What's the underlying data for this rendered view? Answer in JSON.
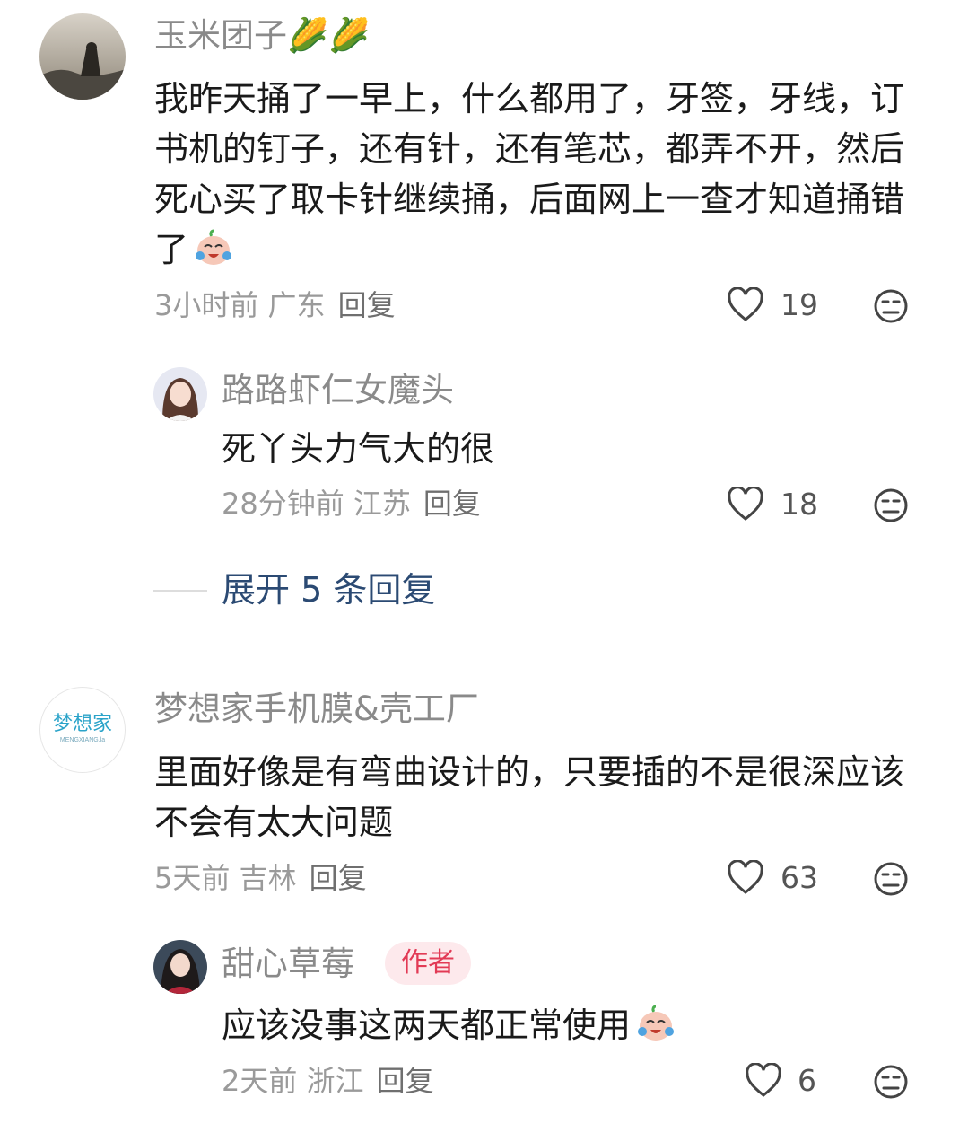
{
  "comments": [
    {
      "username": "玉米团子",
      "username_emoji": "🌽🌽",
      "text": "我昨天捅了一早上，什么都用了，牙签，牙线，订书机的钉子，还有针，还有笔芯，都弄不开，然后死心买了取卡针继续捅，后面网上一查才知道捅错了",
      "emoji": "cry-laugh-emoji",
      "time": "3小时前",
      "location": "广东",
      "reply_label": "回复",
      "likes": "19",
      "replies": [
        {
          "username": "路路虾仁女魔头",
          "text": "死丫头力气大的很",
          "time": "28分钟前",
          "location": "江苏",
          "reply_label": "回复",
          "likes": "18"
        }
      ],
      "expand_label": "展开 5 条回复"
    },
    {
      "username": "梦想家手机膜&壳工厂",
      "avatar_text": "梦想家",
      "avatar_subtext": "MENGXIANG.la",
      "text": "里面好像是有弯曲设计的，只要插的不是很深应该不会有太大问题",
      "time": "5天前",
      "location": "吉林",
      "reply_label": "回复",
      "likes": "63",
      "replies": [
        {
          "username": "甜心草莓",
          "badge": "作者",
          "text": "应该没事这两天都正常使用",
          "emoji": "cry-laugh-emoji",
          "time": "2天前",
          "location": "浙江",
          "reply_label": "回复",
          "likes": "6"
        }
      ]
    }
  ],
  "colors": {
    "username": "#8a8a8a",
    "text": "#1a1a1a",
    "expand": "#2b4a73",
    "author_badge_bg": "#fde9ec",
    "author_badge_text": "#e23a55"
  }
}
